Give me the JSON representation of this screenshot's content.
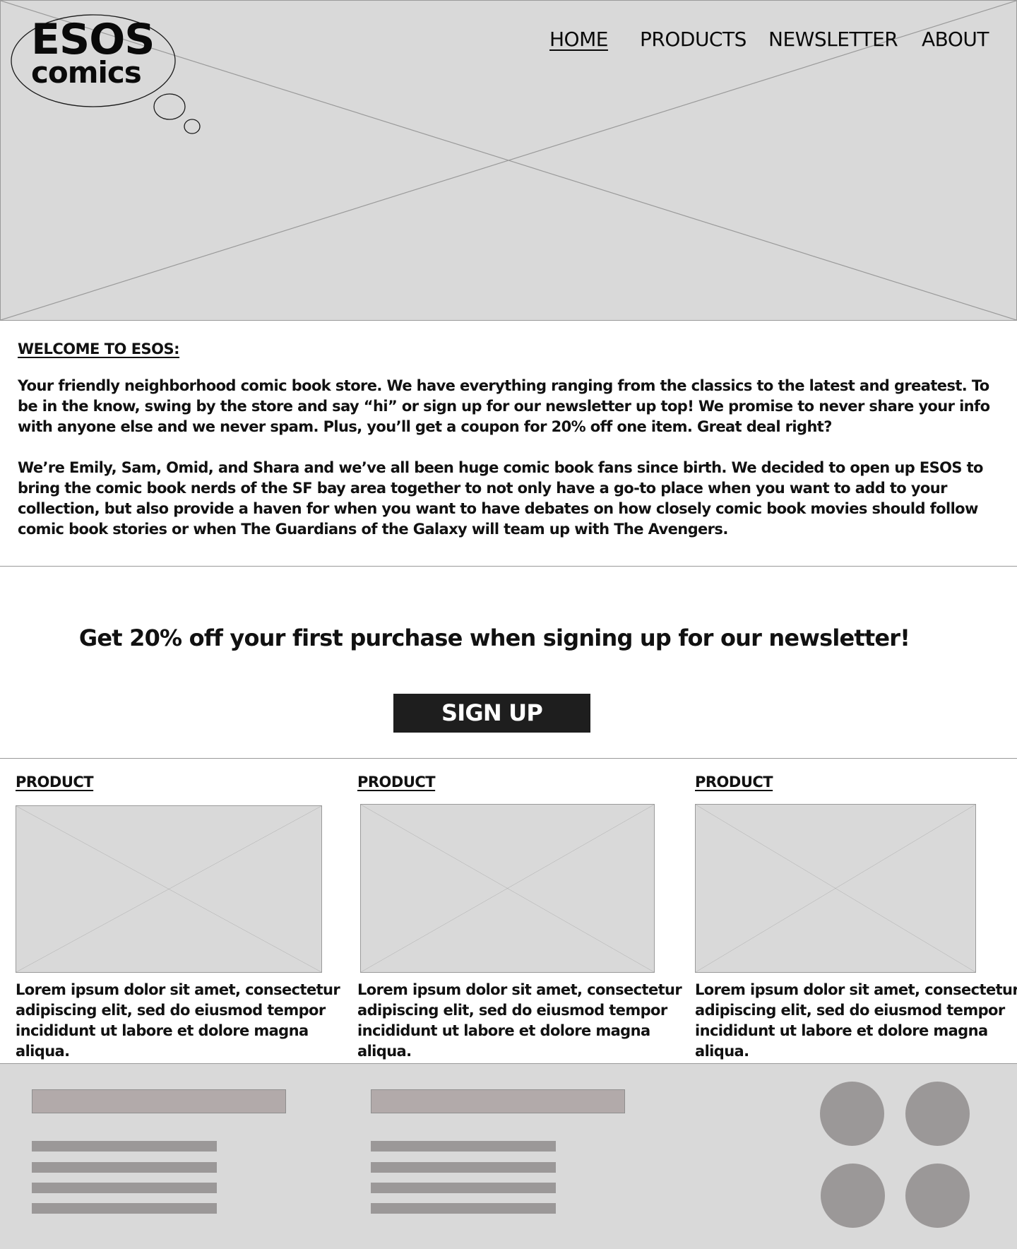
{
  "brand": {
    "logo_line1": "ESOS",
    "logo_line2": "comics"
  },
  "nav": {
    "items": [
      {
        "label": "HOME",
        "active": true
      },
      {
        "label": "PRODUCTS"
      },
      {
        "label": "NEWSLETTER"
      },
      {
        "label": "ABOUT"
      }
    ]
  },
  "hero": {
    "image": "image-placeholder-icon"
  },
  "welcome": {
    "heading": "WELCOME TO ESOS:",
    "paragraphs": [
      "Your friendly neighborhood comic book store. We have everything ranging from the classics to the latest and greatest. To be in the know, swing by the store and say “hi” or sign up for our newsletter up top! We promise to never share your info with anyone else and we never spam. Plus, you’ll get a coupon for 20% off one item. Great deal right?",
      "We’re Emily, Sam, Omid, and Shara and we’ve all been huge comic book fans since birth. We decided to open up ESOS to bring the comic book nerds of the SF bay area together to not only have a go-to place when you want to add to your collection, but also provide a haven for when you want to have debates on how closely comic book movies should follow comic book stories or when The Guardians of the Galaxy will team up with The Avengers."
    ]
  },
  "promo": {
    "text": "Get 20% off your first purchase when signing up for our newsletter!",
    "button_label": "SIGN UP"
  },
  "products": [
    {
      "title": "PRODUCT",
      "description": "Lorem ipsum dolor sit amet, consectetur adipiscing elit, sed do eiusmod tempor incididunt ut labore et dolore magna aliqua."
    },
    {
      "title": "PRODUCT",
      "description": "Lorem ipsum dolor sit amet, consectetur adipiscing elit, sed do eiusmod tempor incididunt ut labore et dolore magna aliqua."
    },
    {
      "title": "PRODUCT",
      "description": "Lorem ipsum dolor sit amet, consectetur adipiscing elit, sed do eiusmod tempor incididunt ut labore et dolore magna aliqua."
    }
  ],
  "colors": {
    "placeholder_fill": "#d9d9d9",
    "placeholder_stroke": "#9a9a9a",
    "button_bg": "#1e1e1e",
    "footer_bar": "#b2aaaa",
    "footer_line": "#9b9898"
  }
}
